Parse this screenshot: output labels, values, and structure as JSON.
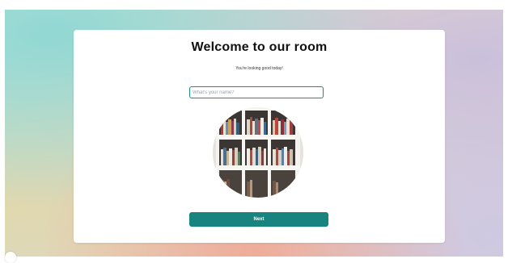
{
  "welcome": {
    "title": "Welcome to our room",
    "subtitle": "You're looking good today!",
    "name_input": {
      "placeholder": "What's your name?",
      "value": ""
    },
    "next_label": "Next"
  },
  "colors": {
    "accent": "#17847f",
    "input_border": "#1a8c87",
    "card": "#ffffff"
  },
  "icons": {
    "camera_preview": "bookshelf-photo"
  }
}
